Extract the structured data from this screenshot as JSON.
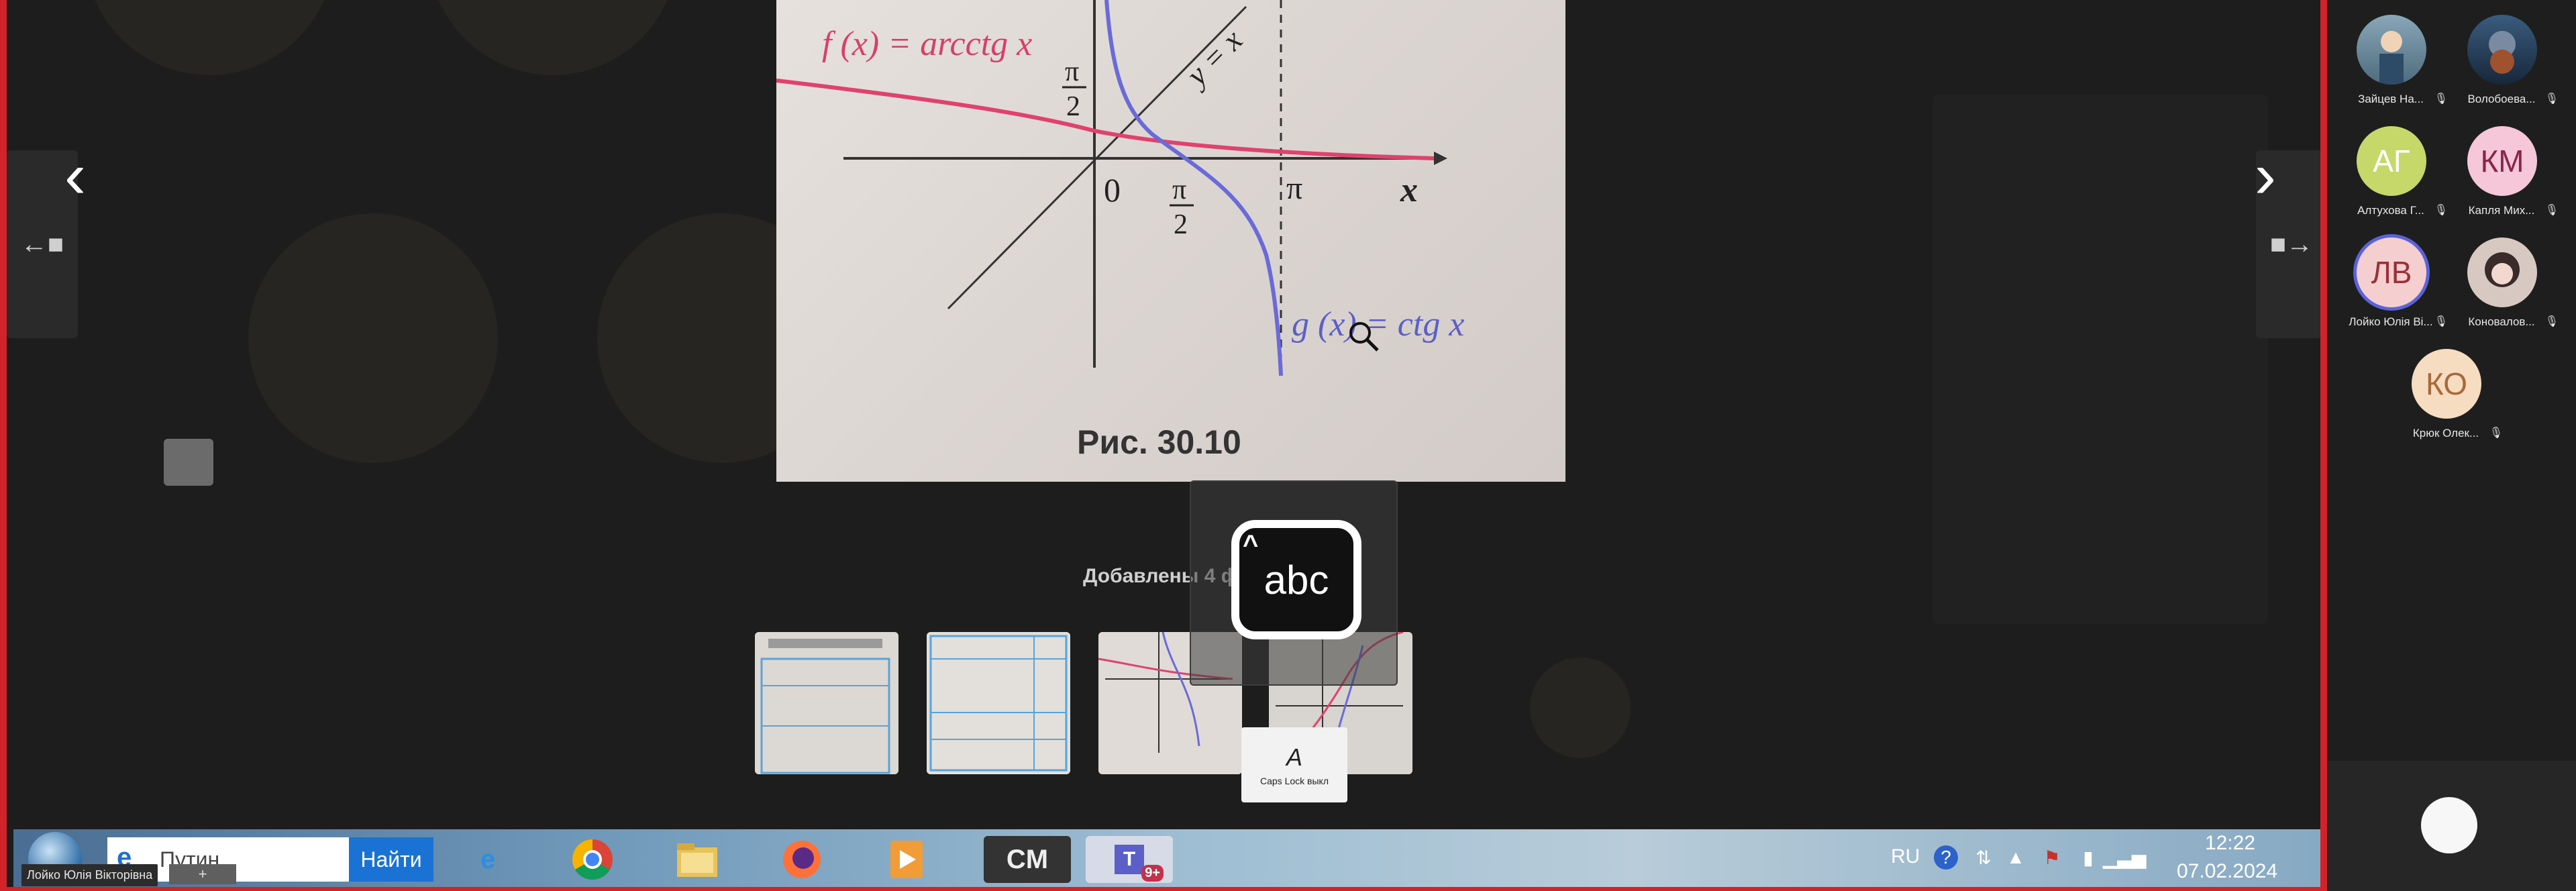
{
  "photo": {
    "f_label": "f (x) = arcctg  x",
    "g_label": "g (x) = ctg  x",
    "yx_label": "y = x",
    "pi_half_num": "π",
    "pi_half_den": "2",
    "zero": "0",
    "pi": "π",
    "x_axis": "x",
    "caption": "Рис. 30.10"
  },
  "gallery": {
    "added_label": "Добавлены 4 фото",
    "thumbnails": [
      "photo-1",
      "photo-2",
      "photo-3",
      "photo-4"
    ]
  },
  "overlay": {
    "abc_text": "abc",
    "abc_caret": "^",
    "caps_icon": "A",
    "caps_text": "Caps Lock выкл"
  },
  "taskbar": {
    "search_placeholder": "Путин",
    "search_button": "Найти",
    "user_label": "Лойко Юлія Вікторівна",
    "plus": "+",
    "cm_label": "CM",
    "teams_label": "T",
    "teams_badge": "9+",
    "lang": "RU",
    "time": "12:22",
    "date": "07.02.2024"
  },
  "participants": [
    {
      "name": "Зайцев На...",
      "initials": "",
      "color": "#5a7c8f",
      "photo": true
    },
    {
      "name": "Волобоева...",
      "initials": "",
      "color": "#2b4a66",
      "photo": true
    },
    {
      "name": "Алтухова Г...",
      "initials": "АГ",
      "color": "#c7d86b",
      "text": "#ffffff"
    },
    {
      "name": "Капля Мих...",
      "initials": "КМ",
      "color": "#f6c7d9",
      "text": "#8a2647"
    },
    {
      "name": "Лойко Юлія Ві...",
      "initials": "ЛВ",
      "color": "#f5cfd0",
      "text": "#9a3039",
      "ring": "#5a63d9"
    },
    {
      "name": "Коновалов...",
      "initials": "",
      "color": "#d7c9c2",
      "photo": true
    },
    {
      "name": "Крюк Олек...",
      "initials": "КО",
      "color": "#f6dcc0",
      "text": "#a8693a"
    }
  ],
  "colors": {
    "frame_red": "#d2232a",
    "teams_purple": "#5b5fc7",
    "search_blue": "#1a73d4"
  }
}
